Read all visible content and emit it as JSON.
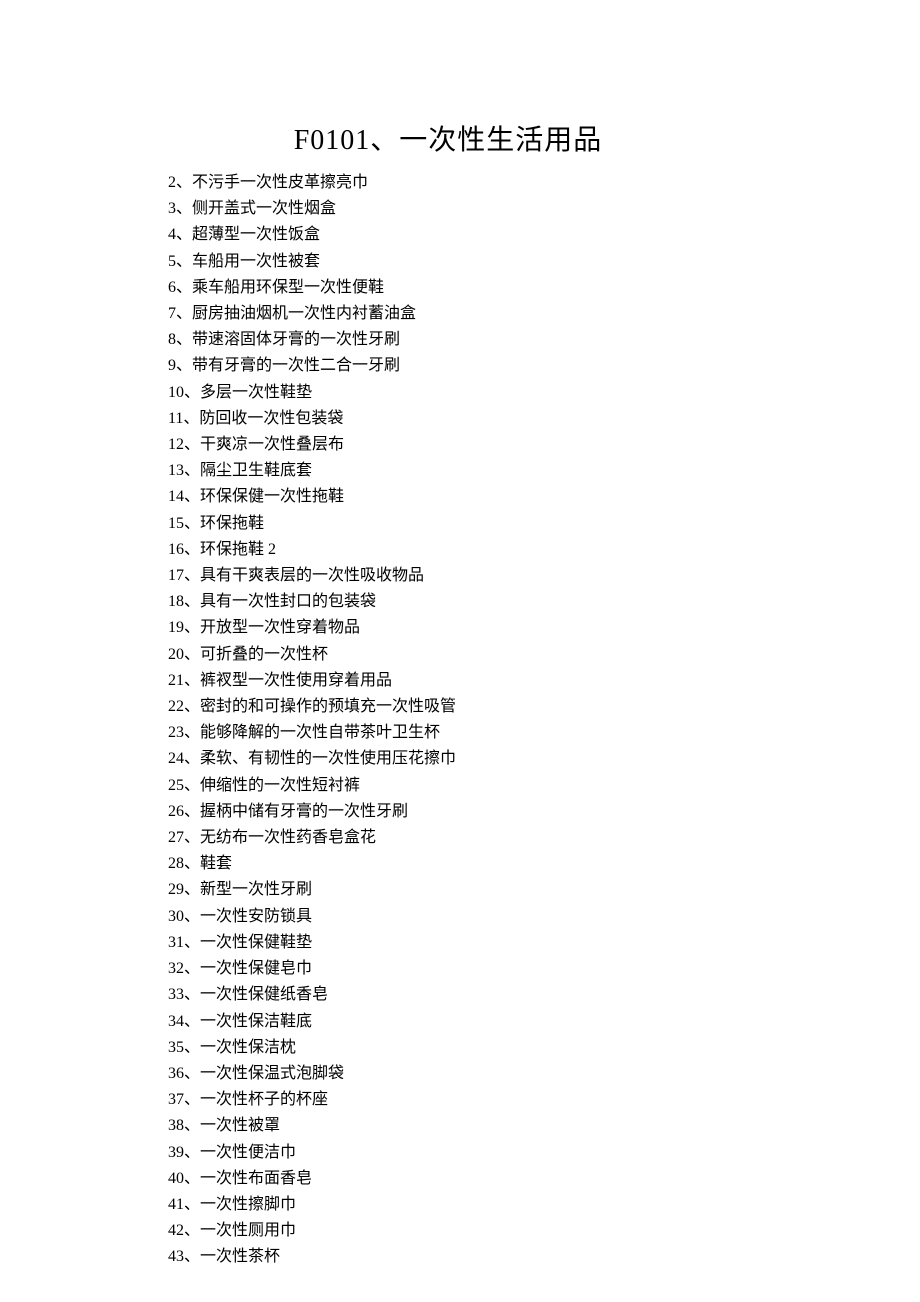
{
  "title": "F0101、一次性生活用品",
  "items": [
    {
      "num": "2",
      "text": "不污手一次性皮革擦亮巾"
    },
    {
      "num": "3",
      "text": "侧开盖式一次性烟盒"
    },
    {
      "num": "4",
      "text": "超薄型一次性饭盒"
    },
    {
      "num": "5",
      "text": "车船用一次性被套"
    },
    {
      "num": "6",
      "text": "乘车船用环保型一次性便鞋"
    },
    {
      "num": "7",
      "text": "厨房抽油烟机一次性内衬蓄油盒"
    },
    {
      "num": "8",
      "text": "带速溶固体牙膏的一次性牙刷"
    },
    {
      "num": "9",
      "text": "带有牙膏的一次性二合一牙刷"
    },
    {
      "num": "10",
      "text": "多层一次性鞋垫"
    },
    {
      "num": "11",
      "text": "防回收一次性包装袋"
    },
    {
      "num": "12",
      "text": "干爽凉一次性叠层布"
    },
    {
      "num": "13",
      "text": "隔尘卫生鞋底套"
    },
    {
      "num": "14",
      "text": "环保保健一次性拖鞋"
    },
    {
      "num": "15",
      "text": "环保拖鞋"
    },
    {
      "num": "16",
      "text": "环保拖鞋 2"
    },
    {
      "num": "17",
      "text": "具有干爽表层的一次性吸收物品"
    },
    {
      "num": "18",
      "text": "具有一次性封口的包装袋"
    },
    {
      "num": "19",
      "text": "开放型一次性穿着物品"
    },
    {
      "num": "20",
      "text": "可折叠的一次性杯"
    },
    {
      "num": "21",
      "text": "裤衩型一次性使用穿着用品"
    },
    {
      "num": "22",
      "text": "密封的和可操作的预填充一次性吸管"
    },
    {
      "num": "23",
      "text": "能够降解的一次性自带茶叶卫生杯"
    },
    {
      "num": "24",
      "text": "柔软、有韧性的一次性使用压花擦巾"
    },
    {
      "num": "25",
      "text": "伸缩性的一次性短衬裤"
    },
    {
      "num": "26",
      "text": "握柄中储有牙膏的一次性牙刷"
    },
    {
      "num": "27",
      "text": "无纺布一次性药香皂盒花"
    },
    {
      "num": "28",
      "text": "鞋套"
    },
    {
      "num": "29",
      "text": "新型一次性牙刷"
    },
    {
      "num": "30",
      "text": "一次性安防锁具"
    },
    {
      "num": "31",
      "text": "一次性保健鞋垫"
    },
    {
      "num": "32",
      "text": "一次性保健皂巾"
    },
    {
      "num": "33",
      "text": "一次性保健纸香皂"
    },
    {
      "num": "34",
      "text": "一次性保洁鞋底"
    },
    {
      "num": "35",
      "text": "一次性保洁枕"
    },
    {
      "num": "36",
      "text": "一次性保温式泡脚袋"
    },
    {
      "num": "37",
      "text": "一次性杯子的杯座"
    },
    {
      "num": "38",
      "text": "一次性被罩"
    },
    {
      "num": "39",
      "text": "一次性便洁巾"
    },
    {
      "num": "40",
      "text": "一次性布面香皂"
    },
    {
      "num": "41",
      "text": "一次性擦脚巾"
    },
    {
      "num": "42",
      "text": "一次性厕用巾"
    },
    {
      "num": "43",
      "text": "一次性茶杯"
    }
  ]
}
